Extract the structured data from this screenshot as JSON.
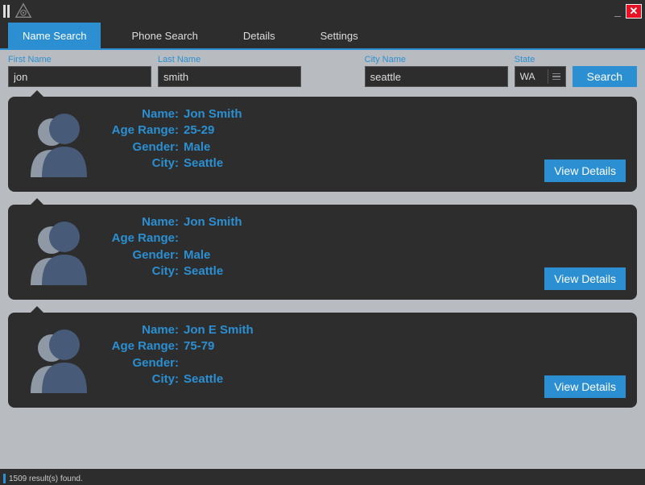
{
  "colors": {
    "accent": "#2b8fd1",
    "bg": "#2d2d2d",
    "panel": "#b8bcc0"
  },
  "tabs": [
    {
      "label": "Name Search",
      "active": true
    },
    {
      "label": "Phone Search",
      "active": false
    },
    {
      "label": "Details",
      "active": false
    },
    {
      "label": "Settings",
      "active": false
    }
  ],
  "filters": {
    "first_name": {
      "label": "First Name",
      "value": "jon"
    },
    "last_name": {
      "label": "Last Name",
      "value": "smith"
    },
    "city_name": {
      "label": "City Name",
      "value": "seattle"
    },
    "state": {
      "label": "State",
      "value": "WA"
    },
    "search_label": "Search"
  },
  "labels": {
    "name": "Name:",
    "age_range": "Age Range:",
    "gender": "Gender:",
    "city": "City:",
    "view_details": "View Details"
  },
  "results": [
    {
      "name": "Jon Smith",
      "age_range": "25-29",
      "gender": "Male",
      "city": "Seattle"
    },
    {
      "name": "Jon Smith",
      "age_range": "",
      "gender": "Male",
      "city": "Seattle"
    },
    {
      "name": "Jon E Smith",
      "age_range": "75-79",
      "gender": "",
      "city": "Seattle"
    }
  ],
  "status": "1509 result(s) found."
}
